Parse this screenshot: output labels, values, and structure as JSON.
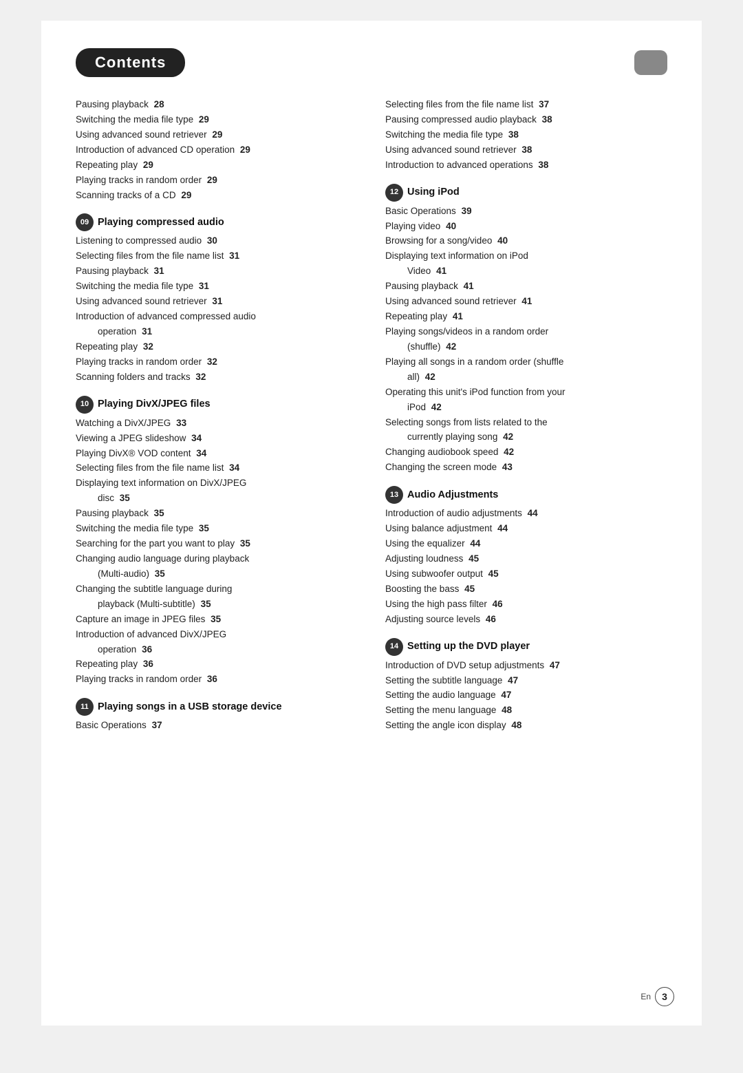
{
  "title": "Contents",
  "title_box_label": "Contents",
  "page_lang": "En",
  "page_num": "3",
  "left_col": {
    "pre_entries": [
      {
        "label": "Pausing playback",
        "page": "28"
      },
      {
        "label": "Switching the media file type",
        "page": "29"
      },
      {
        "label": "Using advanced sound retriever",
        "page": "29"
      },
      {
        "label": "Introduction of advanced CD operation",
        "page": "29"
      },
      {
        "label": "Repeating play",
        "page": "29"
      },
      {
        "label": "Playing tracks in random order",
        "page": "29"
      },
      {
        "label": "Scanning tracks of a CD",
        "page": "29"
      }
    ],
    "sections": [
      {
        "num": "09",
        "title": "Playing compressed audio",
        "entries": [
          {
            "label": "Listening to compressed audio",
            "page": "30"
          },
          {
            "label": "Selecting files from the file name list",
            "page": "31"
          },
          {
            "label": "Pausing playback",
            "page": "31"
          },
          {
            "label": "Switching the media file type",
            "page": "31"
          },
          {
            "label": "Using advanced sound retriever",
            "page": "31"
          },
          {
            "label": "Introduction of advanced compressed audio",
            "indent": true,
            "label2": "operation",
            "page": "31"
          },
          {
            "label": "Repeating play",
            "page": "32"
          },
          {
            "label": "Playing tracks in random order",
            "page": "32"
          },
          {
            "label": "Scanning folders and tracks",
            "page": "32"
          }
        ]
      },
      {
        "num": "10",
        "title": "Playing DivX/JPEG files",
        "entries": [
          {
            "label": "Watching a DivX/JPEG",
            "page": "33"
          },
          {
            "label": "Viewing a JPEG slideshow",
            "page": "34"
          },
          {
            "label": "Playing DivX® VOD content",
            "page": "34"
          },
          {
            "label": "Selecting files from the file name list",
            "page": "34"
          },
          {
            "label": "Displaying text information on DivX/JPEG",
            "indent": true,
            "label2": "disc",
            "page": "35"
          },
          {
            "label": "Pausing playback",
            "page": "35"
          },
          {
            "label": "Switching the media file type",
            "page": "35"
          },
          {
            "label": "Searching for the part you want to play",
            "page": "35"
          },
          {
            "label": "Changing audio language during playback",
            "indent": true,
            "label2": "(Multi-audio)",
            "page": "35"
          },
          {
            "label": "Changing the subtitle language during",
            "indent": true,
            "label2": "playback (Multi-subtitle)",
            "page": "35"
          },
          {
            "label": "Capture an image in JPEG files",
            "page": "35"
          },
          {
            "label": "Introduction of advanced DivX/JPEG",
            "indent": true,
            "label2": "operation",
            "page": "36"
          },
          {
            "label": "Repeating play",
            "page": "36"
          },
          {
            "label": "Playing tracks in random order",
            "page": "36"
          }
        ]
      },
      {
        "num": "11",
        "title": "Playing songs in a USB storage device",
        "entries": [
          {
            "label": "Basic Operations",
            "page": "37"
          }
        ]
      }
    ]
  },
  "right_col": {
    "pre_entries": [
      {
        "label": "Selecting files from the file name list",
        "page": "37"
      },
      {
        "label": "Pausing compressed audio playback",
        "page": "38"
      },
      {
        "label": "Switching the media file type",
        "page": "38"
      },
      {
        "label": "Using advanced sound retriever",
        "page": "38"
      },
      {
        "label": "Introduction to advanced operations",
        "page": "38"
      }
    ],
    "sections": [
      {
        "num": "12",
        "title": "Using iPod",
        "entries": [
          {
            "label": "Basic Operations",
            "page": "39"
          },
          {
            "label": "Playing video",
            "page": "40"
          },
          {
            "label": "Browsing for a song/video",
            "page": "40"
          },
          {
            "label": "Displaying text information on iPod",
            "indent": true,
            "label2": "Video",
            "page": "41"
          },
          {
            "label": "Pausing playback",
            "page": "41"
          },
          {
            "label": "Using advanced sound retriever",
            "page": "41"
          },
          {
            "label": "Repeating play",
            "page": "41"
          },
          {
            "label": "Playing songs/videos in a random order",
            "indent": true,
            "label2": "(shuffle)",
            "page": "42"
          },
          {
            "label": "Playing all songs in a random order (shuffle",
            "indent": true,
            "label2": "all)",
            "page": "42"
          },
          {
            "label": "Operating this unit's iPod function from your",
            "indent": true,
            "label2": "iPod",
            "page": "42"
          },
          {
            "label": "Selecting songs from lists related to the",
            "indent": true,
            "label2": "currently playing song",
            "page": "42"
          },
          {
            "label": "Changing audiobook speed",
            "page": "42"
          },
          {
            "label": "Changing the screen mode",
            "page": "43"
          }
        ]
      },
      {
        "num": "13",
        "title": "Audio Adjustments",
        "entries": [
          {
            "label": "Introduction of audio adjustments",
            "page": "44"
          },
          {
            "label": "Using balance adjustment",
            "page": "44"
          },
          {
            "label": "Using the equalizer",
            "page": "44"
          },
          {
            "label": "Adjusting loudness",
            "page": "45"
          },
          {
            "label": "Using subwoofer output",
            "page": "45"
          },
          {
            "label": "Boosting the bass",
            "page": "45"
          },
          {
            "label": "Using the high pass filter",
            "page": "46"
          },
          {
            "label": "Adjusting source levels",
            "page": "46"
          }
        ]
      },
      {
        "num": "14",
        "title": "Setting up the DVD player",
        "entries": [
          {
            "label": "Introduction of DVD setup adjustments",
            "page": "47"
          },
          {
            "label": "Setting the subtitle language",
            "page": "47"
          },
          {
            "label": "Setting the audio language",
            "page": "47"
          },
          {
            "label": "Setting the menu language",
            "page": "48"
          },
          {
            "label": "Setting the angle icon display",
            "page": "48"
          }
        ]
      }
    ]
  }
}
